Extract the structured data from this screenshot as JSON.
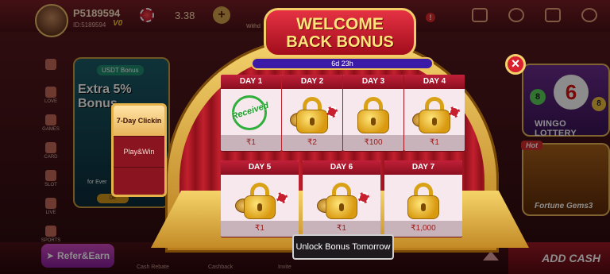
{
  "header": {
    "username": "P5189594",
    "user_id": "ID:5189594",
    "vip": "V0",
    "balance": "3.38",
    "withdraw_label": "Withd",
    "alert_count": "!"
  },
  "sidebar": {
    "items": [
      {
        "label": "",
        "icon": "gift-icon"
      },
      {
        "label": "LOVE",
        "icon": "heart-icon"
      },
      {
        "label": "GAMES",
        "icon": "gamepad-icon"
      },
      {
        "label": "CARD",
        "icon": "card-icon"
      },
      {
        "label": "SLOT",
        "icon": "slot-icon"
      },
      {
        "label": "LIVE",
        "icon": "tv-icon"
      },
      {
        "label": "SPORTS",
        "icon": "ball-icon"
      }
    ]
  },
  "promo": {
    "usdt_badge": "USDT Bonus",
    "headline": "Extra 5% Bonus",
    "for_every": "for Ever",
    "deposit_btn": "DE"
  },
  "tabs": [
    {
      "label": "7-Day Clickin",
      "active": true
    },
    {
      "label": "Play&Win",
      "active": false
    },
    {
      "label": "",
      "active": false
    }
  ],
  "right_cards": {
    "wingo_label": "WINGO LOTTERY",
    "hot_badge": "Hot",
    "gems_label": "Fortune Gems3"
  },
  "bottom": {
    "refer_label": "Refer&Earn",
    "labels": [
      "Cash Rebate",
      "Cashback",
      "Invite"
    ],
    "add_cash_label": "ADD CASH"
  },
  "modal": {
    "title_line1": "WELCOME",
    "title_line2": "BACK BONUS",
    "timer": "6d 23h",
    "received_label": "Received",
    "unlock_button": "Unlock Bonus Tomorrow",
    "close_icon": "close-icon",
    "days": [
      {
        "label": "DAY 1",
        "amount": "₹1",
        "state": "received"
      },
      {
        "label": "DAY 2",
        "amount": "₹2",
        "state": "locked"
      },
      {
        "label": "DAY 3",
        "amount": "₹100",
        "state": "locked"
      },
      {
        "label": "DAY 4",
        "amount": "₹1",
        "state": "locked"
      },
      {
        "label": "DAY 5",
        "amount": "₹1",
        "state": "locked"
      },
      {
        "label": "DAY 6",
        "amount": "₹1",
        "state": "locked"
      },
      {
        "label": "DAY 7",
        "amount": "₹1,000",
        "state": "locked"
      }
    ]
  },
  "colors": {
    "accent_gold": "#f3cd6a",
    "accent_red": "#c02039",
    "received_green": "#2faf3b"
  }
}
